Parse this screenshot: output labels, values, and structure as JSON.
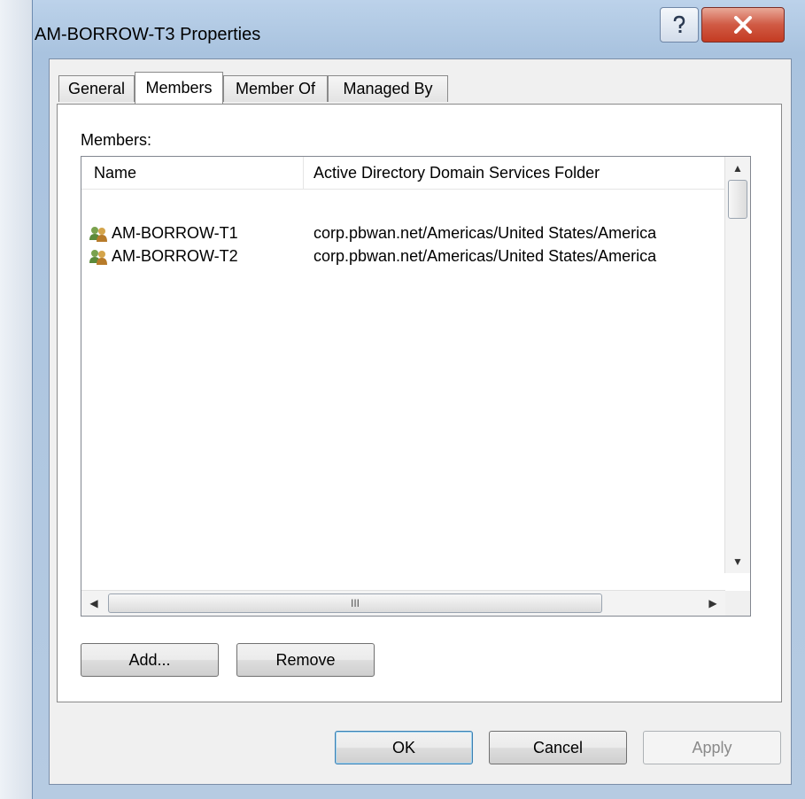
{
  "window": {
    "title": "AM-BORROW-T3 Properties"
  },
  "tabs": [
    {
      "label": "General",
      "active": false
    },
    {
      "label": "Members",
      "active": true
    },
    {
      "label": "Member Of",
      "active": false
    },
    {
      "label": "Managed By",
      "active": false
    }
  ],
  "members": {
    "label": "Members:",
    "columns": {
      "name": "Name",
      "folder": "Active Directory Domain Services Folder"
    },
    "rows": [
      {
        "name": "AM-BORROW-T1",
        "folder": "corp.pbwan.net/Americas/United States/America"
      },
      {
        "name": "AM-BORROW-T2",
        "folder": "corp.pbwan.net/Americas/United States/America"
      }
    ],
    "hscroll_thumb_glyph": "III"
  },
  "panel_buttons": {
    "add": "Add...",
    "remove": "Remove"
  },
  "dialog_buttons": {
    "ok": "OK",
    "cancel": "Cancel",
    "apply": "Apply"
  },
  "icons": {
    "help": "help-icon",
    "close": "close-icon",
    "group": "group-icon"
  },
  "colors": {
    "close_button": "#c43b22",
    "title_bar": "#bcd2ea",
    "default_button_border": "#3c7fb1"
  }
}
